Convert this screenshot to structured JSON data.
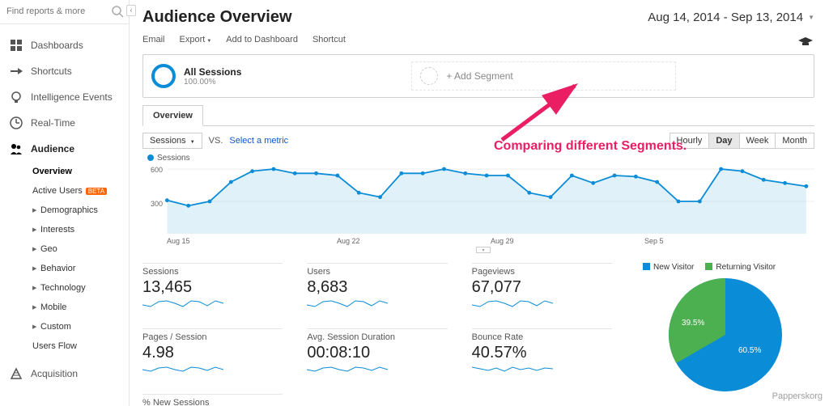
{
  "search": {
    "placeholder": "Find reports & more"
  },
  "sidebar": {
    "items": [
      {
        "label": "Dashboards",
        "icon": "dashboards-icon"
      },
      {
        "label": "Shortcuts",
        "icon": "shortcuts-icon"
      },
      {
        "label": "Intelligence Events",
        "icon": "bulb-icon"
      },
      {
        "label": "Real-Time",
        "icon": "clock-icon"
      },
      {
        "label": "Audience",
        "icon": "audience-icon"
      },
      {
        "label": "Acquisition",
        "icon": "acquisition-icon"
      }
    ],
    "audience_sub": {
      "overview": "Overview",
      "active_users": "Active Users",
      "beta": "BETA",
      "demographics": "Demographics",
      "interests": "Interests",
      "geo": "Geo",
      "behavior": "Behavior",
      "technology": "Technology",
      "mobile": "Mobile",
      "custom": "Custom",
      "users_flow": "Users Flow"
    }
  },
  "header": {
    "title": "Audience Overview",
    "date_range": "Aug 14, 2014 - Sep 13, 2014"
  },
  "toolbar": {
    "email": "Email",
    "export": "Export",
    "add_dashboard": "Add to Dashboard",
    "shortcut": "Shortcut"
  },
  "segment": {
    "title": "All Sessions",
    "sub": "100.00%",
    "add": "+ Add Segment"
  },
  "tabs": {
    "overview": "Overview"
  },
  "chart_controls": {
    "metric": "Sessions",
    "vs": "VS.",
    "select_metric": "Select a metric",
    "hourly": "Hourly",
    "day": "Day",
    "week": "Week",
    "month": "Month"
  },
  "chart_legend": "Sessions",
  "chart_data": {
    "type": "line",
    "title": "Sessions",
    "xlabel": "",
    "ylabel": "Sessions",
    "ylim": [
      0,
      600
    ],
    "yticks": [
      300,
      600
    ],
    "categories": [
      "Aug 14",
      "Aug 15",
      "Aug 16",
      "Aug 17",
      "Aug 18",
      "Aug 19",
      "Aug 20",
      "Aug 21",
      "Aug 22",
      "Aug 23",
      "Aug 24",
      "Aug 25",
      "Aug 26",
      "Aug 27",
      "Aug 28",
      "Aug 29",
      "Aug 30",
      "Aug 31",
      "Sep 1",
      "Sep 2",
      "Sep 3",
      "Sep 4",
      "Sep 5",
      "Sep 6",
      "Sep 7",
      "Sep 8",
      "Sep 9",
      "Sep 10",
      "Sep 11",
      "Sep 12",
      "Sep 13"
    ],
    "x_tick_labels": [
      "Aug 15",
      "Aug 22",
      "Aug 29",
      "Sep 5"
    ],
    "series": [
      {
        "name": "Sessions",
        "color": "#0b8cd6",
        "values": [
          310,
          260,
          300,
          480,
          580,
          600,
          560,
          560,
          540,
          380,
          340,
          560,
          560,
          600,
          560,
          540,
          540,
          380,
          340,
          540,
          470,
          540,
          530,
          480,
          300,
          300,
          600,
          580,
          500,
          470,
          440
        ]
      }
    ]
  },
  "metrics": {
    "sessions": {
      "label": "Sessions",
      "value": "13,465"
    },
    "users": {
      "label": "Users",
      "value": "8,683"
    },
    "pageviews": {
      "label": "Pageviews",
      "value": "67,077"
    },
    "pages_session": {
      "label": "Pages / Session",
      "value": "4.98"
    },
    "avg_duration": {
      "label": "Avg. Session Duration",
      "value": "00:08:10"
    },
    "bounce_rate": {
      "label": "Bounce Rate",
      "value": "40.57%"
    },
    "new_sessions": {
      "label": "% New Sessions"
    }
  },
  "pie": {
    "legend": {
      "new": "New Visitor",
      "returning": "Returning Visitor"
    },
    "data": {
      "type": "pie",
      "slices": [
        {
          "name": "New Visitor",
          "value": 60.5,
          "label": "60.5%",
          "color": "#0b8cd6"
        },
        {
          "name": "Returning Visitor",
          "value": 39.5,
          "label": "39.5%",
          "color": "#4caf50"
        }
      ]
    }
  },
  "annotation": "Comparing different Segments.",
  "watermark": "Papperskorg"
}
